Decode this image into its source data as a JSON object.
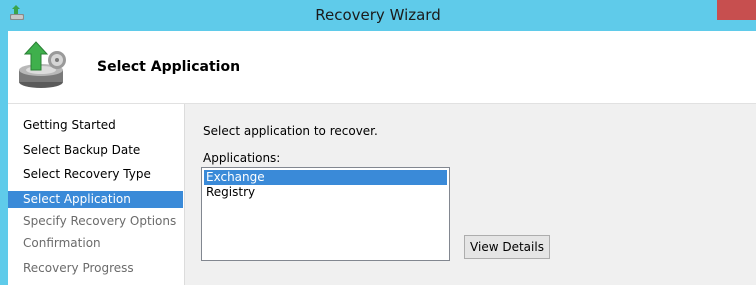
{
  "window": {
    "title": "Recovery Wizard",
    "header_title": "Select Application"
  },
  "nav": {
    "items": [
      {
        "label": "Getting Started",
        "state": "done"
      },
      {
        "label": "Select Backup Date",
        "state": "done"
      },
      {
        "label": "Select Recovery Type",
        "state": "done"
      },
      {
        "label": "Select Application",
        "state": "active"
      },
      {
        "label": "Specify Recovery Options",
        "state": "pending"
      },
      {
        "label": "Confirmation",
        "state": "pending"
      },
      {
        "label": "Recovery Progress",
        "state": "pending"
      }
    ]
  },
  "content": {
    "instruction": "Select application to recover.",
    "apps_label": "Applications:",
    "applications": [
      {
        "label": "Exchange",
        "selected": true
      },
      {
        "label": "Registry",
        "selected": false
      }
    ],
    "view_details_label": "View Details"
  },
  "colors": {
    "titlebar": "#5fcbea",
    "selection": "#3a8ad8",
    "close": "#c74f4f"
  },
  "icons": {
    "app_icon": "recovery-wizard-icon",
    "header_icon": "backup-drive-icon"
  }
}
